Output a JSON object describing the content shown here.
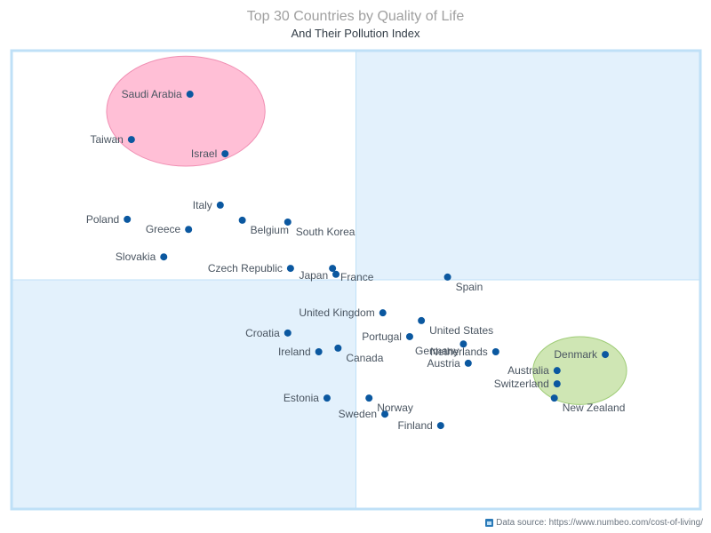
{
  "chart_data": {
    "type": "scatter",
    "title": "Top 30 Countries by Quality of Life",
    "subtitle": "And Their Pollution Index",
    "xlabel": "",
    "ylabel": "",
    "axes_note": "No axis ticks shown; values are relative plot positions (x: 0=left, 100=right; y: 0=bottom, 100=top)",
    "xlim": [
      0,
      100
    ],
    "ylim": [
      0,
      100
    ],
    "grid": false,
    "legend": "none",
    "quadrants": {
      "divider_x": 50,
      "divider_y": 50,
      "shaded": [
        "top-right",
        "bottom-left"
      ],
      "shade_color": "#e3f1fc",
      "border_color": "#bfe0f7"
    },
    "highlights": [
      {
        "name": "worst-cluster",
        "color": "#ffbfd6",
        "stroke": "#f08fb3",
        "cx": 25.3,
        "cy": 86.8,
        "rx": 11.5,
        "ry": 12.0
      },
      {
        "name": "best-cluster",
        "color": "#cfe6b4",
        "stroke": "#9fcc77",
        "cx": 82.5,
        "cy": 30.2,
        "rx": 6.8,
        "ry": 7.4
      }
    ],
    "point_color": "#0b58a0",
    "series": [
      {
        "name": "Countries",
        "points": [
          {
            "label": "Saudi Arabia",
            "x": 25.9,
            "y": 90.5,
            "label_pos": "left"
          },
          {
            "label": "Taiwan",
            "x": 17.4,
            "y": 80.6,
            "label_pos": "left"
          },
          {
            "label": "Israel",
            "x": 31.0,
            "y": 77.5,
            "label_pos": "left"
          },
          {
            "label": "Italy",
            "x": 30.3,
            "y": 66.3,
            "label_pos": "left"
          },
          {
            "label": "Poland",
            "x": 16.8,
            "y": 63.2,
            "label_pos": "left"
          },
          {
            "label": "Belgium",
            "x": 33.5,
            "y": 63.0,
            "label_pos": "below-right"
          },
          {
            "label": "South Korea",
            "x": 40.1,
            "y": 62.6,
            "label_pos": "below-right"
          },
          {
            "label": "Greece",
            "x": 25.7,
            "y": 61.0,
            "label_pos": "left"
          },
          {
            "label": "Slovakia",
            "x": 22.1,
            "y": 55.0,
            "label_pos": "left"
          },
          {
            "label": "Czech Republic",
            "x": 40.5,
            "y": 52.5,
            "label_pos": "left"
          },
          {
            "label": "Japan",
            "x": 46.6,
            "y": 52.5,
            "label_pos": "below-left"
          },
          {
            "label": "France",
            "x": 47.1,
            "y": 51.2,
            "label_pos": "right"
          },
          {
            "label": "Spain",
            "x": 63.3,
            "y": 50.6,
            "label_pos": "below-right"
          },
          {
            "label": "United Kingdom",
            "x": 53.9,
            "y": 42.8,
            "label_pos": "left"
          },
          {
            "label": "United States",
            "x": 59.5,
            "y": 41.1,
            "label_pos": "below-right"
          },
          {
            "label": "Portugal",
            "x": 57.8,
            "y": 37.6,
            "label_pos": "left"
          },
          {
            "label": "Croatia",
            "x": 40.1,
            "y": 38.4,
            "label_pos": "left"
          },
          {
            "label": "Germany",
            "x": 65.6,
            "y": 36.0,
            "label_pos": "below-left"
          },
          {
            "label": "Netherlands",
            "x": 70.3,
            "y": 34.3,
            "label_pos": "left"
          },
          {
            "label": "Canada",
            "x": 47.4,
            "y": 35.1,
            "label_pos": "below-right"
          },
          {
            "label": "Ireland",
            "x": 44.6,
            "y": 34.3,
            "label_pos": "left"
          },
          {
            "label": "Austria",
            "x": 66.3,
            "y": 31.8,
            "label_pos": "left"
          },
          {
            "label": "Denmark",
            "x": 86.2,
            "y": 33.7,
            "label_pos": "left"
          },
          {
            "label": "Australia",
            "x": 79.2,
            "y": 30.2,
            "label_pos": "left"
          },
          {
            "label": "Switzerland",
            "x": 79.2,
            "y": 27.3,
            "label_pos": "left"
          },
          {
            "label": "New Zealand",
            "x": 78.8,
            "y": 24.2,
            "label_pos": "below-right"
          },
          {
            "label": "Estonia",
            "x": 45.8,
            "y": 24.2,
            "label_pos": "left"
          },
          {
            "label": "Norway",
            "x": 51.9,
            "y": 24.2,
            "label_pos": "below-right"
          },
          {
            "label": "Sweden",
            "x": 54.2,
            "y": 20.7,
            "label_pos": "left"
          },
          {
            "label": "Finland",
            "x": 62.3,
            "y": 18.2,
            "label_pos": "left"
          }
        ]
      }
    ]
  },
  "footer": {
    "source_icon": "data-source-icon",
    "source_text": "Data source: https://www.numbeo.com/cost-of-living/"
  }
}
